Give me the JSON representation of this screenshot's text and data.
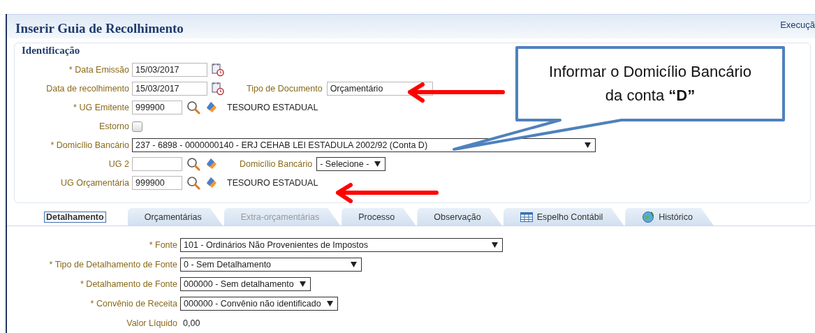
{
  "header": {
    "title": "Inserir Guia de Recolhimento",
    "link": "Execuçã"
  },
  "identification": {
    "title": "Identificação",
    "rows": [
      {
        "kind": "date",
        "label": "* Data Emissão",
        "value": "15/03/2017"
      },
      {
        "kind": "date",
        "label": "Data de recolhimento",
        "value": "15/03/2017",
        "extra": {
          "kind": "text",
          "label": "Tipo de Documento",
          "value": "Orçamentário"
        }
      },
      {
        "kind": "lookup",
        "label": "* UG Emitente",
        "value": "999900",
        "name": "TESOURO ESTADUAL"
      },
      {
        "kind": "checkbox",
        "label": "Estorno",
        "checked": false
      },
      {
        "kind": "select",
        "label": "* Domicílio Bancário",
        "value": "237 - 6898 - 0000000140 - ERJ CEHAB LEI ESTADULA 2002/92 (Conta D)"
      },
      {
        "kind": "lookup",
        "label": "UG 2",
        "extra": {
          "kind": "select",
          "label": "Domicílio Bancário",
          "value": "- Selecione -"
        }
      },
      {
        "kind": "lookup",
        "label": "UG Orçamentária",
        "value": "999900",
        "name": "TESOURO ESTADUAL"
      }
    ]
  },
  "tabs": [
    {
      "label": "Detalhamento",
      "selected": true,
      "disabled": false,
      "kind": "plain"
    },
    {
      "label": "Orçamentárias",
      "selected": false,
      "disabled": false,
      "kind": "plain"
    },
    {
      "label": "Extra-orçamentárias",
      "selected": false,
      "disabled": true,
      "kind": "plain"
    },
    {
      "label": "Processo",
      "selected": false,
      "disabled": false,
      "kind": "plain"
    },
    {
      "label": "Observação",
      "selected": false,
      "disabled": false,
      "kind": "plain"
    },
    {
      "label": "Espelho Contábil",
      "selected": false,
      "disabled": false,
      "kind": "table"
    },
    {
      "label": "Histórico",
      "selected": false,
      "disabled": false,
      "kind": "history"
    }
  ],
  "detail": [
    {
      "kind": "select",
      "label": "* Fonte",
      "value": "101 - Ordinários Não Provenientes de Impostos"
    },
    {
      "kind": "select",
      "label": "* Tipo de Detalhamento de Fonte",
      "value": "0 - Sem Detalhamento"
    },
    {
      "kind": "select",
      "label": "* Detalhamento de Fonte",
      "value": "000000 - Sem detalhamento"
    },
    {
      "kind": "select",
      "label": "* Convênio de Receita",
      "value": "000000 - Convênio não identificado"
    },
    {
      "kind": "text",
      "label": "Valor Líquido",
      "value": "0,00"
    }
  ],
  "callout": {
    "text": "Informar o Domicílio Bancário da conta **“D”**"
  }
}
